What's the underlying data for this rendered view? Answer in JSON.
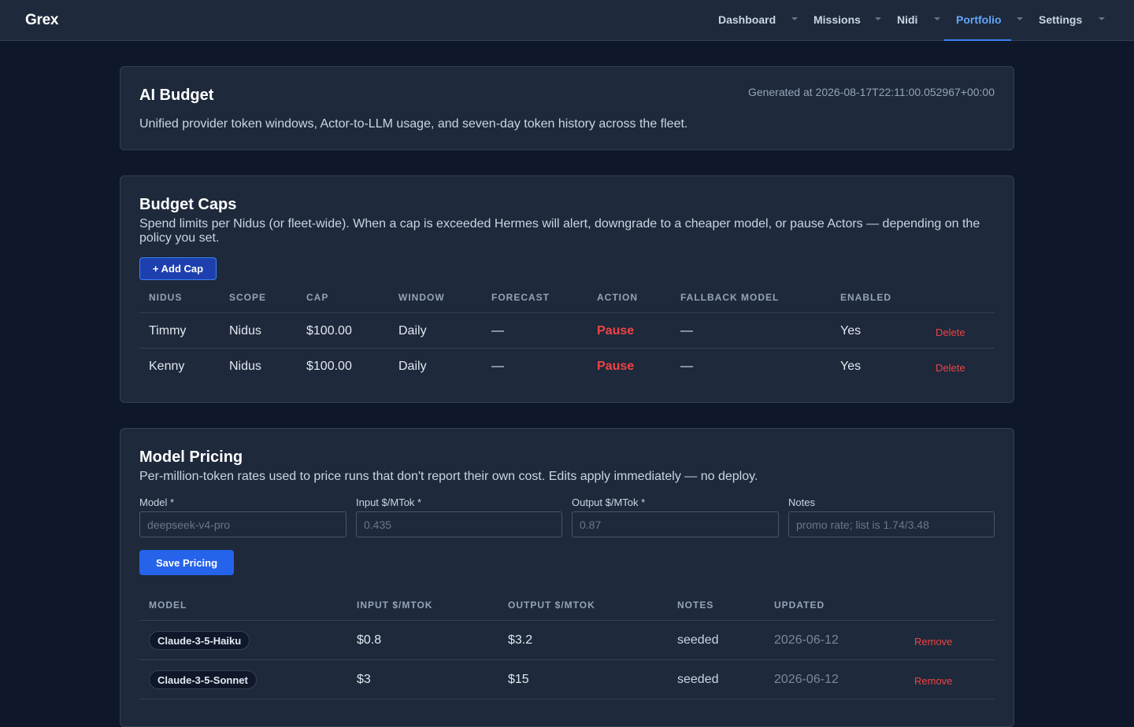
{
  "app": {
    "brand": "Grex"
  },
  "nav": {
    "items": [
      {
        "label": "Dashboard"
      },
      {
        "label": "Missions"
      },
      {
        "label": "Nidi"
      },
      {
        "label": "Portfolio",
        "active": true
      },
      {
        "label": "Settings"
      }
    ]
  },
  "header": {
    "title": "AI Budget",
    "generated": "Generated at 2026-08-17T22:11:00.052967+00:00",
    "description": "Unified provider token windows, Actor-to-LLM usage, and seven-day token history across the fleet."
  },
  "caps": {
    "title": "Budget Caps",
    "description": "Spend limits per Nidus (or fleet-wide). When a cap is exceeded Hermes will alert, downgrade to a cheaper model, or pause Actors — depending on the policy you set.",
    "add_label": "+ Add Cap",
    "columns": [
      "Nidus",
      "Scope",
      "Cap",
      "Window",
      "Forecast",
      "Action",
      "Fallback Model",
      "Enabled"
    ],
    "delete_label": "Delete",
    "rows": [
      {
        "nidus": "Timmy",
        "scope": "Nidus",
        "cap": "$100.00",
        "window": "Daily",
        "forecast": "—",
        "action": "Pause",
        "fallback": "—",
        "enabled": "Yes"
      },
      {
        "nidus": "Kenny",
        "scope": "Nidus",
        "cap": "$100.00",
        "window": "Daily",
        "forecast": "—",
        "action": "Pause",
        "fallback": "—",
        "enabled": "Yes"
      }
    ]
  },
  "pricing": {
    "title": "Model Pricing",
    "description": "Per-million-token rates used to price runs that don't report their own cost. Edits apply immediately — no deploy.",
    "form": {
      "model_label": "Model *",
      "model_placeholder": "deepseek-v4-pro",
      "input_label": "Input $/MTok *",
      "input_placeholder": "0.435",
      "output_label": "Output $/MTok *",
      "output_placeholder": "0.87",
      "notes_label": "Notes",
      "notes_placeholder": "promo rate; list is 1.74/3.48"
    },
    "save_label": "Save Pricing",
    "columns": [
      "Model",
      "Input $/MTok",
      "Output $/MTok",
      "Notes",
      "Updated"
    ],
    "remove_label": "Remove",
    "rows": [
      {
        "model": "Claude-3-5-Haiku",
        "input": "$0.8",
        "output": "$3.2",
        "notes": "seeded",
        "updated": "2026-06-12"
      },
      {
        "model": "Claude-3-5-Sonnet",
        "input": "$3",
        "output": "$15",
        "notes": "seeded",
        "updated": "2026-06-12"
      }
    ]
  },
  "colors": {
    "background": "#0f172a",
    "surface": "#1e293b",
    "accent": "#3b82f6",
    "danger": "#ef4444"
  }
}
